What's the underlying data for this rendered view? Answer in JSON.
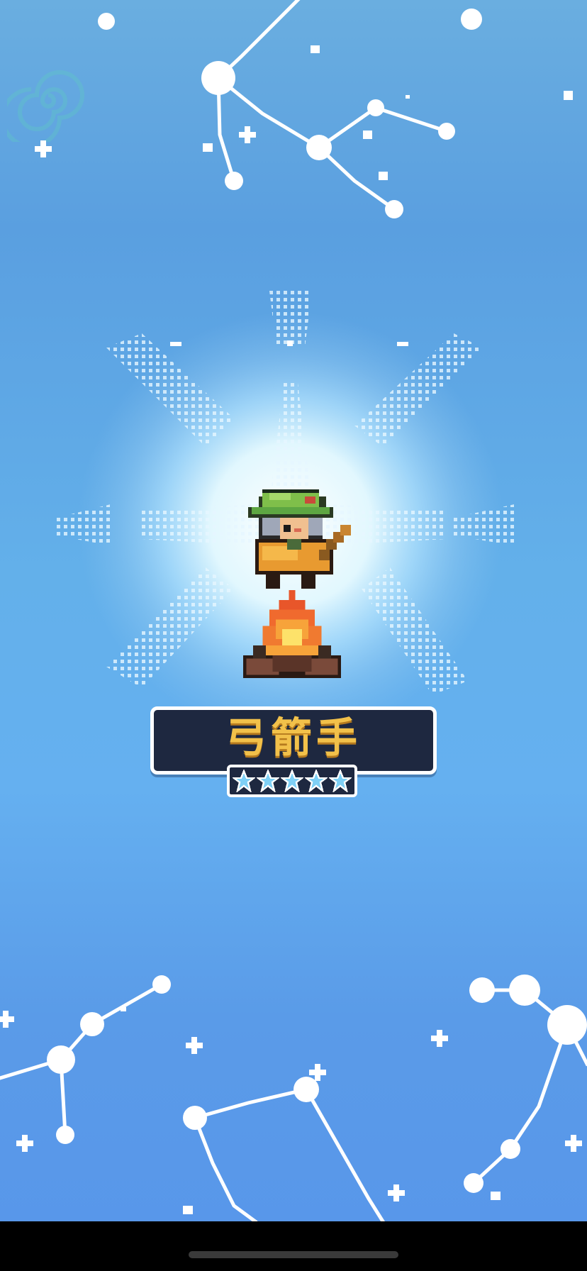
{
  "hero": {
    "name": "弓箭手",
    "star_rating": 5,
    "max_stars": 5
  },
  "colors": {
    "sky_top": "#6aaee0",
    "sky_bottom": "#5896ea",
    "name_plate": "#1e2840",
    "name_text": "#f2c14a",
    "star_fill": "#7fd0f5",
    "constellation": "#ffffff"
  },
  "icons": [
    "spiral-icon",
    "star-icon",
    "campfire-icon",
    "archer-sprite"
  ]
}
